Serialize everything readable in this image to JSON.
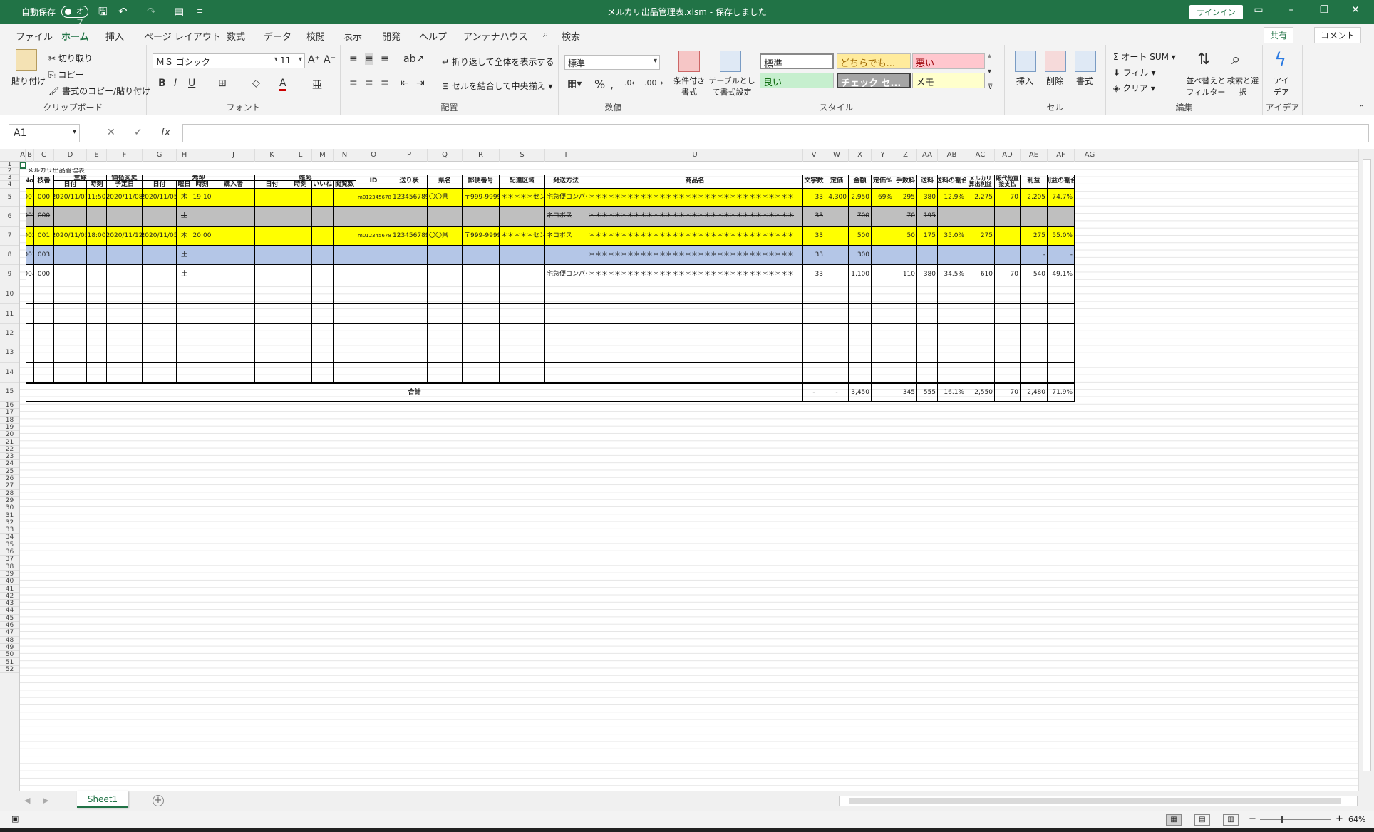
{
  "titlebar": {
    "autosave": "自動保存",
    "toggle": "オフ",
    "title": "メルカリ出品管理表.xlsm  -  保存しました",
    "signin": "サインイン"
  },
  "menu": {
    "tabs": [
      "ファイル",
      "ホーム",
      "挿入",
      "ページ レイアウト",
      "数式",
      "データ",
      "校閲",
      "表示",
      "開発",
      "ヘルプ",
      "アンテナハウス"
    ],
    "search": "検索",
    "share": "共有",
    "comment": "コメント"
  },
  "ribbon": {
    "clipboard": {
      "paste": "貼り付け",
      "cut": "切り取り",
      "copy": "コピー",
      "format_painter": "書式のコピー/貼り付け",
      "label": "クリップボード"
    },
    "font": {
      "name": "ＭＳ ゴシック",
      "size": "11",
      "label": "フォント"
    },
    "alignment": {
      "wrap": "折り返して全体を表示する",
      "merge": "セルを結合して中央揃え",
      "label": "配置"
    },
    "number": {
      "format": "標準",
      "label": "数値"
    },
    "styles": {
      "conditional": "条件付き書式",
      "table": "テーブルとして書式設定",
      "label": "スタイル",
      "cells": [
        "標準",
        "どちらでも...",
        "悪い",
        "良い",
        "チェック セ...",
        "メモ"
      ]
    },
    "cells": {
      "insert": "挿入",
      "delete": "削除",
      "format": "書式",
      "label": "セル"
    },
    "editing": {
      "autosum": "オート SUM",
      "fill": "フィル",
      "clear": "クリア",
      "sort": "並べ替えとフィルター",
      "find": "検索と選択",
      "label": "編集"
    },
    "ideas": {
      "btn": "アイデア",
      "label": "アイデア"
    }
  },
  "formula": {
    "namebox": "A1",
    "fx": "fx"
  },
  "columns": [
    "A",
    "B",
    "C",
    "D",
    "E",
    "F",
    "G",
    "H",
    "I",
    "J",
    "K",
    "L",
    "M",
    "N",
    "O",
    "P",
    "Q",
    "R",
    "S",
    "T",
    "U",
    "V",
    "W",
    "X",
    "Y",
    "Z",
    "AA",
    "AB",
    "AC",
    "AD",
    "AE",
    "AF",
    "AG"
  ],
  "sheet": {
    "title": "メルカリ出品管理表",
    "groups": {
      "listing": "登録",
      "price_change": "価格変更",
      "sold": "売却",
      "confirm": "確認"
    },
    "headers": {
      "no": "No.",
      "branch": "枝番",
      "date": "日付",
      "time": "時刻",
      "planned": "予定日",
      "dow": "曜日",
      "buyer": "購入者",
      "likes": "いいね",
      "views": "閲覧数",
      "id": "ID",
      "tracking": "送り状",
      "pref": "県名",
      "zip": "郵便番号",
      "center": "配達区域",
      "method": "発送方法",
      "product": "商品名",
      "chars": "文字数",
      "list_price": "定価",
      "amount": "金額",
      "pct": "定価%",
      "fee": "手数料",
      "shipping": "送料",
      "ship_ratio": "送料の割合",
      "mercari_profit": "メルカリ算出利益",
      "other": "販代他直接支払",
      "profit": "利益",
      "profit_ratio": "利益の割合"
    },
    "rows": [
      {
        "no": "001",
        "branch": "000",
        "date": "2020/11/01",
        "time": "11:50",
        "planned": "2020/11/08",
        "sold_date": "2020/11/05",
        "dow": "木",
        "sold_time": "19:10",
        "id": "m01234567890",
        "tracking": "123456789012",
        "pref": "〇〇県",
        "zip": "〒999-9999",
        "center": "＊＊＊＊＊センター",
        "method": "宅急便コンパクト",
        "product": "＊＊＊＊＊＊＊＊＊＊＊＊＊＊＊＊＊＊＊＊＊＊＊＊＊＊＊＊＊＊＊＊",
        "chars": "33",
        "list_price": "4,300",
        "amount": "2,950",
        "pct": "69%",
        "fee": "295",
        "shipping": "380",
        "ship_ratio": "12.9%",
        "mercari_profit": "2,275",
        "other": "70",
        "profit": "2,205",
        "profit_ratio": "74.7%",
        "bg": "#ffff00",
        "strike": false
      },
      {
        "no": "002",
        "branch": "000",
        "date": "",
        "time": "",
        "planned": "",
        "sold_date": "",
        "dow": "土",
        "sold_time": "",
        "id": "",
        "tracking": "",
        "pref": "",
        "zip": "",
        "center": "",
        "method": "ネコポス",
        "product": "＊＊＊＊＊＊＊＊＊＊＊＊＊＊＊＊＊＊＊＊＊＊＊＊＊＊＊＊＊＊＊＊",
        "chars": "33",
        "list_price": "",
        "amount": "700",
        "pct": "",
        "fee": "70",
        "shipping": "195",
        "ship_ratio": "",
        "mercari_profit": "",
        "other": "",
        "profit": "",
        "profit_ratio": "",
        "bg": "#bfbfbf",
        "strike": true
      },
      {
        "no": "002",
        "branch": "001",
        "date": "2020/11/05",
        "time": "18:00",
        "planned": "2020/11/12",
        "sold_date": "2020/11/05",
        "dow": "木",
        "sold_time": "20:00",
        "id": "m01234567890",
        "tracking": "123456789012",
        "pref": "〇〇県",
        "zip": "〒999-9999",
        "center": "＊＊＊＊＊センター",
        "method": "ネコポス",
        "product": "＊＊＊＊＊＊＊＊＊＊＊＊＊＊＊＊＊＊＊＊＊＊＊＊＊＊＊＊＊＊＊＊",
        "chars": "33",
        "list_price": "",
        "amount": "500",
        "pct": "",
        "fee": "50",
        "shipping": "175",
        "ship_ratio": "35.0%",
        "mercari_profit": "275",
        "other": "",
        "profit": "275",
        "profit_ratio": "55.0%",
        "bg": "#ffff00",
        "strike": false
      },
      {
        "no": "003",
        "branch": "003",
        "date": "",
        "time": "",
        "planned": "",
        "sold_date": "",
        "dow": "土",
        "sold_time": "",
        "id": "",
        "tracking": "",
        "pref": "",
        "zip": "",
        "center": "",
        "method": "",
        "product": "＊＊＊＊＊＊＊＊＊＊＊＊＊＊＊＊＊＊＊＊＊＊＊＊＊＊＊＊＊＊＊＊",
        "chars": "33",
        "list_price": "",
        "amount": "300",
        "pct": "",
        "fee": "",
        "shipping": "",
        "ship_ratio": "",
        "mercari_profit": "",
        "other": "",
        "profit": "-",
        "profit_ratio": "-",
        "bg": "#b4c6e7",
        "strike": false
      },
      {
        "no": "004",
        "branch": "000",
        "date": "",
        "time": "",
        "planned": "",
        "sold_date": "",
        "dow": "土",
        "sold_time": "",
        "id": "",
        "tracking": "",
        "pref": "",
        "zip": "",
        "center": "",
        "method": "宅急便コンパクト",
        "product": "＊＊＊＊＊＊＊＊＊＊＊＊＊＊＊＊＊＊＊＊＊＊＊＊＊＊＊＊＊＊＊＊",
        "chars": "33",
        "list_price": "",
        "amount": "1,100",
        "pct": "",
        "fee": "110",
        "shipping": "380",
        "ship_ratio": "34.5%",
        "mercari_profit": "610",
        "other": "70",
        "profit": "540",
        "profit_ratio": "49.1%",
        "bg": "#ffffff",
        "strike": false
      }
    ],
    "total": {
      "label": "合計",
      "chars": "-",
      "list_price": "-",
      "amount": "3,450",
      "fee": "345",
      "shipping": "555",
      "ship_ratio": "16.1%",
      "mercari_profit": "2,550",
      "other": "70",
      "profit": "2,480",
      "profit_ratio": "71.9%"
    }
  },
  "sheettab": "Sheet1",
  "status": {
    "zoom": "64%"
  }
}
